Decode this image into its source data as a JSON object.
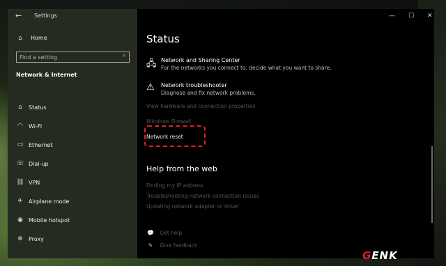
{
  "window": {
    "title": "Settings",
    "back_icon": "←",
    "controls": {
      "minimize": "—",
      "maximize": "☐",
      "close": "✕"
    }
  },
  "sidebar": {
    "home": {
      "icon": "⌂",
      "label": "Home"
    },
    "search": {
      "placeholder": "Find a setting",
      "icon": "⌕"
    },
    "section_title": "Network & Internet",
    "items": [
      {
        "icon": "⌂",
        "label": "Status"
      },
      {
        "icon": "◠",
        "label": "Wi-Fi"
      },
      {
        "icon": "▭",
        "label": "Ethernet"
      },
      {
        "icon": "☏",
        "label": "Dial-up"
      },
      {
        "icon": "⛓",
        "label": "VPN"
      },
      {
        "icon": "✈",
        "label": "Airplane mode"
      },
      {
        "icon": "◉",
        "label": "Mobile hotspot"
      },
      {
        "icon": "⊕",
        "label": "Proxy"
      }
    ]
  },
  "main": {
    "title": "Status",
    "items": [
      {
        "icon": "🖧",
        "title": "Network and Sharing Center",
        "desc": "For the networks you connect to, decide what you want to share."
      },
      {
        "icon": "⚠",
        "title": "Network troubleshooter",
        "desc": "Diagnose and fix network problems."
      }
    ],
    "links": {
      "view_props": "View hardware and connection properties",
      "firewall": "Windows Firewall",
      "network_reset": "Network reset"
    },
    "help": {
      "title": "Help from the web",
      "links": [
        "Finding my IP address",
        "Troubleshooting network connection issues",
        "Updating network adapter or driver"
      ]
    },
    "feedback": {
      "get_help": {
        "icon": "💬",
        "label": "Get help"
      },
      "give_feedback": {
        "icon": "✎",
        "label": "Give feedback"
      }
    }
  },
  "watermark": {
    "g": "G",
    "rest": "ENK"
  },
  "colors": {
    "highlight": "#e0202a",
    "logo": "#e11d2b"
  }
}
